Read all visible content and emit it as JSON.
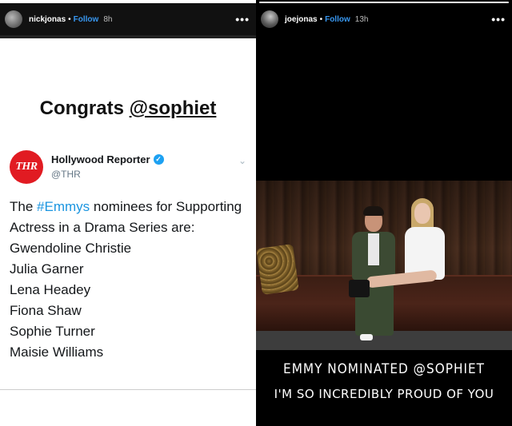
{
  "left_story": {
    "username": "nickjonas",
    "separator": "•",
    "follow_label": "Follow",
    "time": "8h",
    "more_icon": "•••",
    "progress": {
      "segments": 5,
      "completed": 0
    },
    "headline_prefix": "Congrats ",
    "headline_mention": "@sophiet",
    "tweet": {
      "logo_text": "THR",
      "account_name": "Hollywood Reporter",
      "verified_icon": "✓",
      "handle": "@THR",
      "chevron_icon": "⌄",
      "text_prefix": "The ",
      "hashtag": "#Emmys",
      "text_suffix": " nominees for Supporting Actress in a Drama Series are:",
      "nominees": [
        "Gwendoline Christie",
        "Julia Garner",
        "Lena Headey",
        "Fiona Shaw",
        "Sophie Turner",
        "Maisie Williams"
      ]
    }
  },
  "right_story": {
    "username": "joejonas",
    "separator": "•",
    "follow_label": "Follow",
    "time": "13h",
    "more_icon": "•••",
    "progress": {
      "segments": 1,
      "completed": 1
    },
    "caption_line1": "EMMY NOMINATED @SOPHIET",
    "caption_line2": "I'M SO INCREDIBLY PROUD OF YOU"
  },
  "colors": {
    "follow": "#3897f0",
    "hashtag": "#1b95e0",
    "thr_red": "#e11b22",
    "verified": "#1da1f2"
  }
}
